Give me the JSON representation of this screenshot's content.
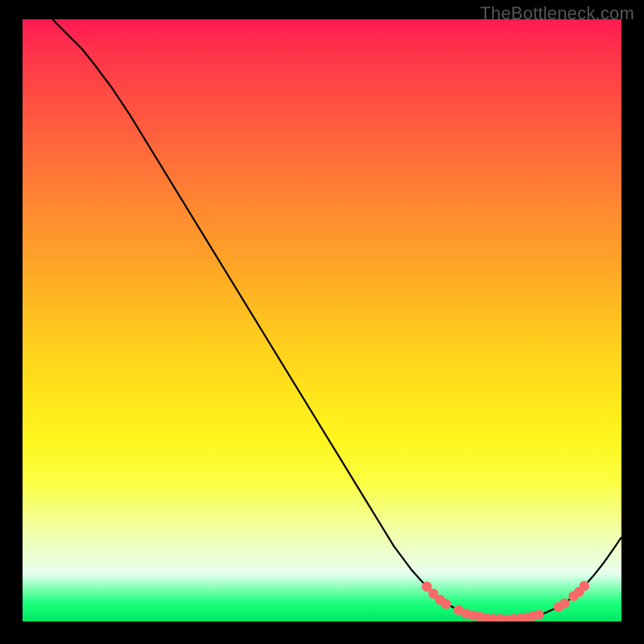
{
  "watermark": "TheBottleneck.com",
  "chart_data": {
    "type": "line",
    "title": "",
    "xlabel": "",
    "ylabel": "",
    "xlim": [
      0,
      100
    ],
    "ylim": [
      0,
      100
    ],
    "curve": [
      {
        "x": 5.0,
        "y": 100.0
      },
      {
        "x": 6.0,
        "y": 99.0
      },
      {
        "x": 8.0,
        "y": 97.0
      },
      {
        "x": 10.0,
        "y": 95.0
      },
      {
        "x": 12.0,
        "y": 92.5
      },
      {
        "x": 15.0,
        "y": 88.5
      },
      {
        "x": 18.0,
        "y": 84.0
      },
      {
        "x": 22.0,
        "y": 77.5
      },
      {
        "x": 26.0,
        "y": 71.0
      },
      {
        "x": 30.0,
        "y": 64.5
      },
      {
        "x": 34.0,
        "y": 58.0
      },
      {
        "x": 38.0,
        "y": 51.5
      },
      {
        "x": 42.0,
        "y": 45.0
      },
      {
        "x": 46.0,
        "y": 38.5
      },
      {
        "x": 50.0,
        "y": 32.0
      },
      {
        "x": 54.0,
        "y": 25.5
      },
      {
        "x": 58.0,
        "y": 19.0
      },
      {
        "x": 62.0,
        "y": 12.5
      },
      {
        "x": 65.0,
        "y": 8.5
      },
      {
        "x": 67.0,
        "y": 6.3
      },
      {
        "x": 69.0,
        "y": 4.3
      },
      {
        "x": 71.0,
        "y": 2.8
      },
      {
        "x": 73.0,
        "y": 1.8
      },
      {
        "x": 75.0,
        "y": 1.0
      },
      {
        "x": 77.0,
        "y": 0.6
      },
      {
        "x": 79.0,
        "y": 0.4
      },
      {
        "x": 81.0,
        "y": 0.3
      },
      {
        "x": 83.0,
        "y": 0.5
      },
      {
        "x": 85.0,
        "y": 0.8
      },
      {
        "x": 87.0,
        "y": 1.3
      },
      {
        "x": 89.0,
        "y": 2.2
      },
      {
        "x": 91.0,
        "y": 3.4
      },
      {
        "x": 92.5,
        "y": 4.6
      },
      {
        "x": 94.0,
        "y": 6.1
      },
      {
        "x": 95.5,
        "y": 7.8
      },
      {
        "x": 97.0,
        "y": 9.7
      },
      {
        "x": 98.5,
        "y": 11.8
      },
      {
        "x": 100.0,
        "y": 14.0
      }
    ],
    "markers": [
      {
        "x": 67.5,
        "y": 5.8
      },
      {
        "x": 68.6,
        "y": 4.6
      },
      {
        "x": 69.7,
        "y": 3.6
      },
      {
        "x": 70.7,
        "y": 2.9
      },
      {
        "x": 72.8,
        "y": 1.9
      },
      {
        "x": 74.1,
        "y": 1.3
      },
      {
        "x": 75.2,
        "y": 1.0
      },
      {
        "x": 76.3,
        "y": 0.8
      },
      {
        "x": 77.5,
        "y": 0.5
      },
      {
        "x": 78.6,
        "y": 0.4
      },
      {
        "x": 79.8,
        "y": 0.4
      },
      {
        "x": 81.0,
        "y": 0.3
      },
      {
        "x": 82.0,
        "y": 0.4
      },
      {
        "x": 83.1,
        "y": 0.5
      },
      {
        "x": 84.1,
        "y": 0.6
      },
      {
        "x": 85.2,
        "y": 0.9
      },
      {
        "x": 86.2,
        "y": 1.1
      },
      {
        "x": 89.5,
        "y": 2.4
      },
      {
        "x": 90.5,
        "y": 3.0
      },
      {
        "x": 92.0,
        "y": 4.2
      },
      {
        "x": 92.9,
        "y": 4.9
      },
      {
        "x": 93.8,
        "y": 5.9
      }
    ],
    "marker_color": "#f86a6a",
    "line_color": "#000000"
  }
}
